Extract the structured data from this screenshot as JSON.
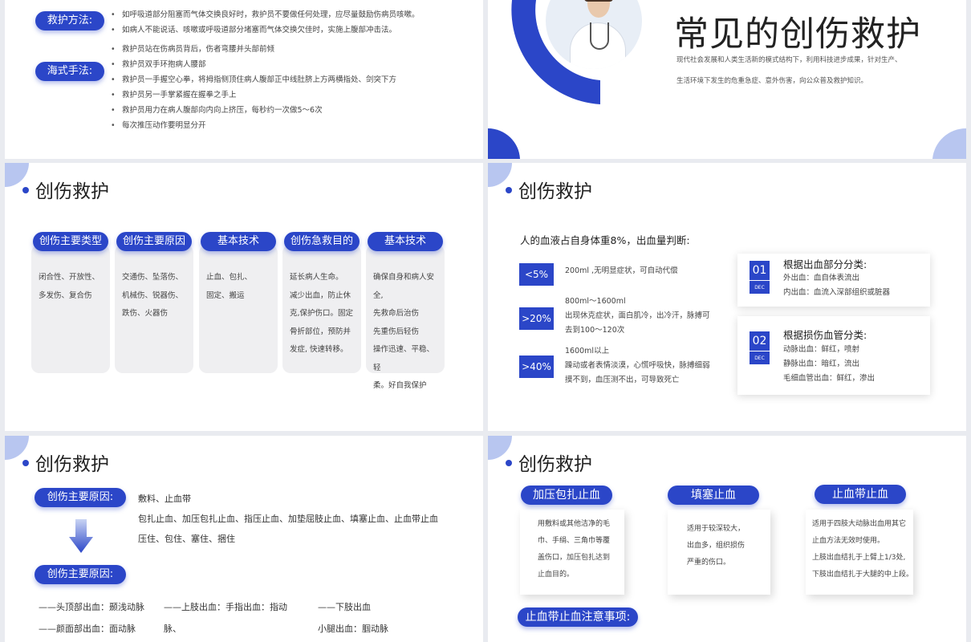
{
  "slide1": {
    "method_label": "救护方法:",
    "method_bullets": [
      "如呼吸道部分阻塞而气体交换良好时，救护员不要做任何处理，应尽量鼓励伤病员咳嗽。",
      "如病人不能说话、咳嗽或呼吸道部分堵塞而气体交换欠佳时，实施上腹部冲击法。"
    ],
    "heimlich_label": "海式手法:",
    "heimlich_bullets": [
      "救护员站在伤病员背后，伤者弯腰并头部前倾",
      "救护员双手环抱病人腰部",
      "救护员一手握空心拳，将拇指侧顶住病人腹部正中线肚脐上方两横指处、剑突下方",
      "救护员另一手掌紧握在握拳之手上",
      "救护员用力在病人腹部向内向上挤压，每秒约一次做5～6次",
      "每次推压动作要明显分开"
    ]
  },
  "slide2": {
    "title": "常见的创伤救护",
    "desc1": "现代社会发展和人类生活新的模式结构下，利用科技进步成果，针对生产、",
    "desc2": "生活环境下发生的危重急症、意外伤害，向公众普及救护知识。"
  },
  "slide3": {
    "title": "创伤救护",
    "cards": [
      {
        "head": "创伤主要类型",
        "lines": [
          "闭合性、开放性、",
          "多发伤、复合伤"
        ]
      },
      {
        "head": "创伤主要原因",
        "lines": [
          "交通伤、坠落伤、",
          "机械伤、锐器伤、",
          "跌伤、火器伤"
        ]
      },
      {
        "head": "基本技术",
        "lines": [
          "止血、包扎、",
          "固定、搬运"
        ]
      },
      {
        "head": "创伤急救目的",
        "lines": [
          "延长病人生命。",
          "减少出血，防止休",
          "克,保护伤口。固定",
          "骨折部位，预防并",
          "发症, 快速转移。"
        ]
      },
      {
        "head": "基本技术",
        "lines": [
          "确保自身和病人安全,",
          "先救命后治伤",
          "先重伤后轻伤",
          "操作迅速、平稳、轻",
          "柔。好自我保护"
        ]
      }
    ]
  },
  "slide4": {
    "title": "创伤救护",
    "intro": "人的血液占自身体重8%，出血量判断:",
    "levels": [
      {
        "tag": "<5%",
        "lines": [
          "200ml ,无明显症状，可自动代偿"
        ]
      },
      {
        "tag": ">20%",
        "lines": [
          "800ml～1600ml",
          "出现休克症状，面白肌冷，出冷汗，脉搏可",
          "去到100～120次"
        ]
      },
      {
        "tag": ">40%",
        "lines": [
          "1600ml以上",
          "躁动或者表情淡漠，心慌呼吸快，脉搏细弱",
          "摸不到，血压测不出，可导致死亡"
        ]
      }
    ],
    "box1": {
      "num": "01",
      "dec": "DEC",
      "title": "根据出血部分分类:",
      "lines": [
        "外出血：血自体表流出",
        "内出血：血流入深部组织或脏器"
      ]
    },
    "box2": {
      "num": "02",
      "dec": "DEC",
      "title": "根据损伤血管分类:",
      "lines": [
        "动脉出血：鲜红，喷射",
        "静脉出血：暗红，流出",
        "毛细血管出血：鲜红，渗出"
      ]
    }
  },
  "slide5": {
    "title": "创伤救护",
    "label1": "创伤主要原因:",
    "line1": "敷料、止血带",
    "line2": "包扎止血、加压包扎止血、指压止血、加垫屈肢止血、填塞止血、止血带止血",
    "line3": "压住、包住、塞住、捆住",
    "label2": "创伤主要原因:",
    "col1": [
      "——头顶部出血：颞浅动脉",
      "——颜面部出血：面动脉"
    ],
    "col2": [
      "——上肢出血：手指出血：指动",
      "脉、"
    ],
    "col3": [
      "——下肢出血",
      "小腿出血：腘动脉"
    ]
  },
  "slide6": {
    "title": "创伤救护",
    "methods": [
      {
        "head": "加压包扎止血",
        "lines": [
          "用敷料或其他洁净的毛",
          "巾、手绢、三角巾等覆",
          "盖伤口，加压包扎达到",
          "止血目的。"
        ]
      },
      {
        "head": "填塞止血",
        "lines": [
          "适用于较深较大，",
          "出血多，组织损伤",
          "严重的伤口。"
        ]
      },
      {
        "head": "止血带止血",
        "lines": [
          "适用于四肢大动脉出血用其它",
          "止血方法无效时使用。",
          "上肢出血结扎于上臂上1/3处,",
          "下肢出血结扎于大腿的中上段。"
        ]
      }
    ],
    "note_label": "止血带止血注意事项:"
  },
  "colors": {
    "accent": "#2b46c8",
    "light_accent": "#b8c6f0"
  }
}
